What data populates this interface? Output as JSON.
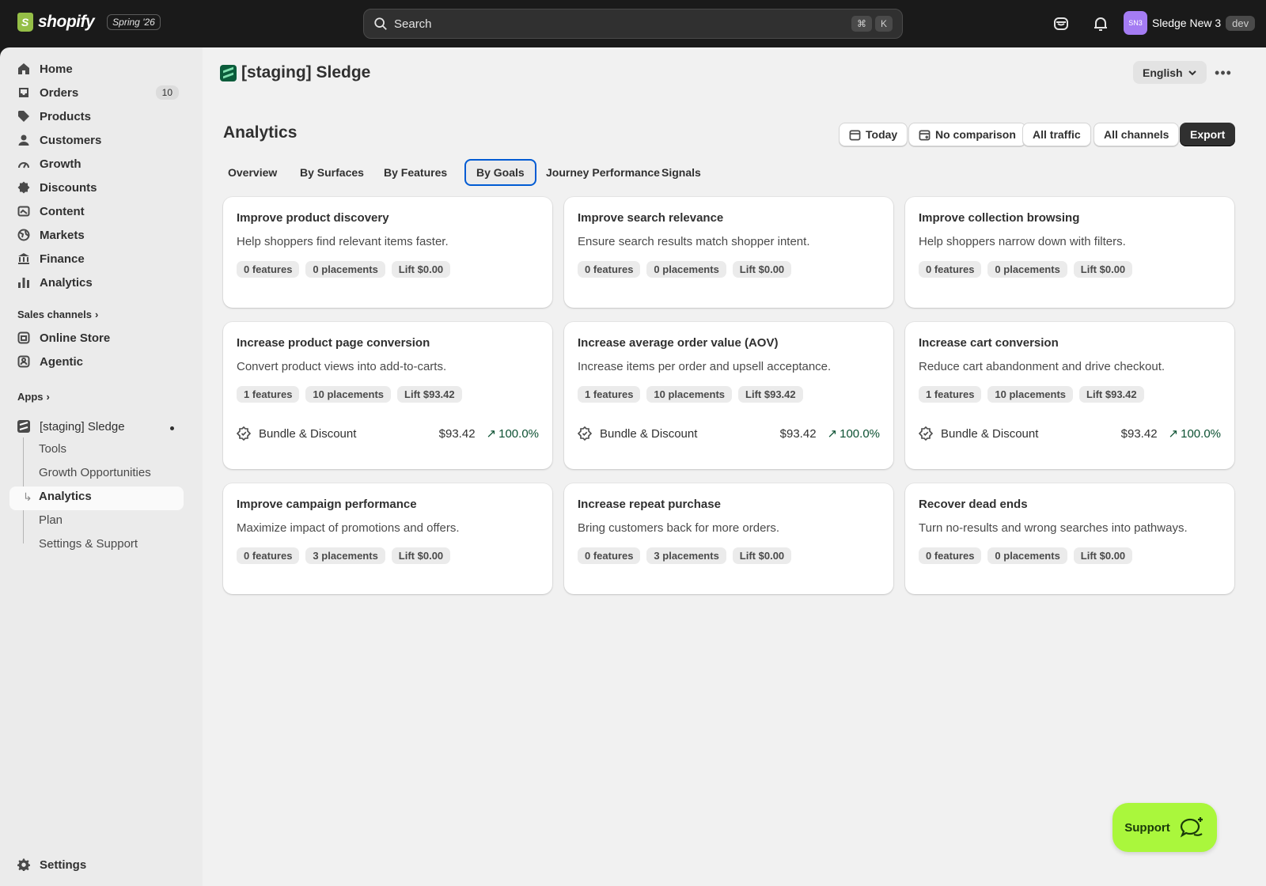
{
  "topbar": {
    "brand": "shopify",
    "edition": "Spring '26",
    "search_placeholder": "Search",
    "shortcut_cmd": "⌘",
    "shortcut_key": "K",
    "avatar_initials": "SN3",
    "store_name": "Sledge New 3",
    "env_badge": "dev"
  },
  "sidebar": {
    "items": [
      {
        "label": "Home",
        "icon": "home-icon"
      },
      {
        "label": "Orders",
        "icon": "orders-icon",
        "badge": "10"
      },
      {
        "label": "Products",
        "icon": "tag-icon"
      },
      {
        "label": "Customers",
        "icon": "person-icon"
      },
      {
        "label": "Growth",
        "icon": "growth-icon"
      },
      {
        "label": "Discounts",
        "icon": "discount-icon"
      },
      {
        "label": "Content",
        "icon": "content-icon"
      },
      {
        "label": "Markets",
        "icon": "globe-icon"
      },
      {
        "label": "Finance",
        "icon": "bank-icon"
      },
      {
        "label": "Analytics",
        "icon": "chart-icon"
      }
    ],
    "sales_channels_label": "Sales channels",
    "channels": [
      {
        "label": "Online Store",
        "icon": "store-icon"
      },
      {
        "label": "Agentic",
        "icon": "agentic-icon"
      }
    ],
    "apps_label": "Apps",
    "app": {
      "label": "[staging] Sledge",
      "subitems": [
        "Tools",
        "Growth Opportunities",
        "Analytics",
        "Plan",
        "Settings & Support"
      ],
      "active_subitem": "Analytics"
    },
    "settings_label": "Settings"
  },
  "header": {
    "app_title": "[staging] Sledge",
    "language": "English"
  },
  "page": {
    "title": "Analytics",
    "filters": {
      "date": "Today",
      "comparison": "No comparison",
      "traffic": "All traffic",
      "channels": "All channels"
    },
    "export_label": "Export",
    "tabs": [
      "Overview",
      "By Surfaces",
      "By Features",
      "By Goals",
      "Journey Performance",
      "Signals"
    ],
    "active_tab": "By Goals"
  },
  "goals": [
    {
      "title": "Improve product discovery",
      "desc": "Help shoppers find relevant items faster.",
      "features": "0 features",
      "placements": "0 placements",
      "lift": "Lift $0.00"
    },
    {
      "title": "Improve search relevance",
      "desc": "Ensure search results match shopper intent.",
      "features": "0 features",
      "placements": "0 placements",
      "lift": "Lift $0.00"
    },
    {
      "title": "Improve collection browsing",
      "desc": "Help shoppers narrow down with filters.",
      "features": "0 features",
      "placements": "0 placements",
      "lift": "Lift $0.00"
    },
    {
      "title": "Increase product page conversion",
      "desc": "Convert product views into add-to-carts.",
      "features": "1 features",
      "placements": "10 placements",
      "lift": "Lift $93.42",
      "feature": {
        "name": "Bundle & Discount",
        "value": "$93.42",
        "change": "100.0%"
      }
    },
    {
      "title": "Increase average order value (AOV)",
      "desc": "Increase items per order and upsell acceptance.",
      "features": "1 features",
      "placements": "10 placements",
      "lift": "Lift $93.42",
      "feature": {
        "name": "Bundle & Discount",
        "value": "$93.42",
        "change": "100.0%"
      }
    },
    {
      "title": "Increase cart conversion",
      "desc": "Reduce cart abandonment and drive checkout.",
      "features": "1 features",
      "placements": "10 placements",
      "lift": "Lift $93.42",
      "feature": {
        "name": "Bundle & Discount",
        "value": "$93.42",
        "change": "100.0%"
      }
    },
    {
      "title": "Improve campaign performance",
      "desc": "Maximize impact of promotions and offers.",
      "features": "0 features",
      "placements": "3 placements",
      "lift": "Lift $0.00"
    },
    {
      "title": "Increase repeat purchase",
      "desc": "Bring customers back for more orders.",
      "features": "0 features",
      "placements": "3 placements",
      "lift": "Lift $0.00"
    },
    {
      "title": "Recover dead ends",
      "desc": "Turn no-results and wrong searches into pathways.",
      "features": "0 features",
      "placements": "0 placements",
      "lift": "Lift $0.00"
    }
  ],
  "support": {
    "label": "Support"
  },
  "colors": {
    "accent": "#005bd3",
    "positive": "#0c5132",
    "support": "#aaf73c",
    "topbar": "#1a1a1a"
  }
}
